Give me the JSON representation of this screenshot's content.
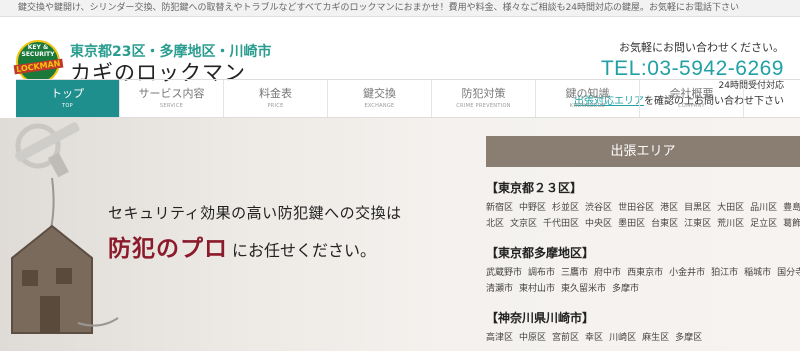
{
  "topbar": {
    "text": "鍵交換や鍵開け、シリンダー交換、防犯鍵への取替えやトラブルなどすべてカギのロックマンにおまかせ！費用や料金、様々なご相談も24時間対応の鍵屋。お気軽にお電話下さい"
  },
  "header": {
    "logo_ring": "KEY & SECURITY",
    "logo_word": "LOCKMAN",
    "subtitle": "東京都23区・多摩地区・川崎市",
    "title": "カギのロックマン"
  },
  "contact": {
    "line1": "お気軽にお問い合わせください。",
    "tel": "TEL:03-5942-6269",
    "hours": "24時間受付対応",
    "area_link": "出張対応エリア",
    "area_rest": "を確認の上お問い合わせ下さい"
  },
  "nav": [
    {
      "jp": "トップ",
      "en": "TOP",
      "active": true
    },
    {
      "jp": "サービス内容",
      "en": "SERVICE"
    },
    {
      "jp": "料金表",
      "en": "PRICE"
    },
    {
      "jp": "鍵交換",
      "en": "EXCHANGE"
    },
    {
      "jp": "防犯対策",
      "en": "CRIME PREVENTION"
    },
    {
      "jp": "鍵の知識",
      "en": "KNOWLEDGE"
    },
    {
      "jp": "会社概要",
      "en": "COMPANY"
    }
  ],
  "hero": {
    "line1": "セキュリティ効果の高い防犯鍵への交換は",
    "big": "防犯のプロ",
    "rest": "にお任せください。"
  },
  "area": {
    "title": "出張エリア",
    "regions": [
      {
        "title": "【東京都２３区】",
        "line1": [
          "新宿区",
          "中野区",
          "杉並区",
          "渋谷区",
          "世田谷区",
          "港区",
          "目黒区",
          "大田区",
          "品川区",
          "豊島区"
        ],
        "line2": [
          "北区",
          "文京区",
          "千代田区",
          "中央区",
          "墨田区",
          "台東区",
          "江東区",
          "荒川区",
          "足立区",
          "葛飾区"
        ]
      },
      {
        "title": "【東京都多摩地区】",
        "line1": [
          "武蔵野市",
          "調布市",
          "三鷹市",
          "府中市",
          "西東京市",
          "小金井市",
          "狛江市",
          "稲城市",
          "国分寺市"
        ],
        "line2": [
          "清瀬市",
          "東村山市",
          "東久留米市",
          "多摩市"
        ]
      },
      {
        "title": "【神奈川県川崎市】",
        "line1": [
          "高津区",
          "中原区",
          "宮前区",
          "幸区",
          "川崎区",
          "麻生区",
          "多摩区"
        ],
        "line2": []
      }
    ]
  },
  "colors": {
    "accent": "#1e8f8c",
    "tel": "#22a1a4",
    "highlight": "#8b1a2b",
    "area_header": "#8a7e73"
  }
}
